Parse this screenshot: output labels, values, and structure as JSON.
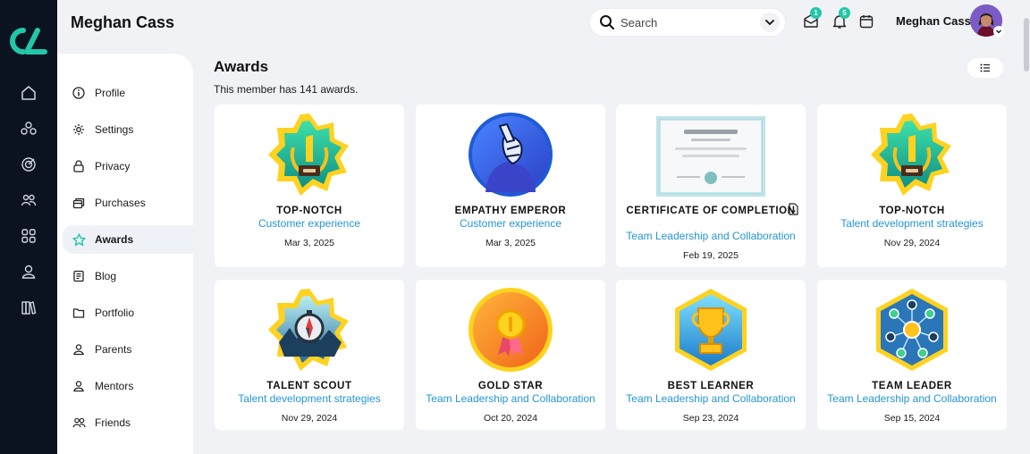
{
  "header": {
    "user_title": "Meghan Cass",
    "search_placeholder": "Search",
    "mail_badge": "1",
    "notifications_badge": "5",
    "user_name": "Meghan Cass"
  },
  "rail": {
    "icons": [
      "home-icon",
      "network-icon",
      "target-icon",
      "users-icon",
      "grid-icon",
      "user-icon",
      "library-icon"
    ]
  },
  "sidebar": {
    "items": [
      {
        "label": "Profile",
        "icon": "info-icon"
      },
      {
        "label": "Settings",
        "icon": "gear-icon"
      },
      {
        "label": "Privacy",
        "icon": "lock-icon"
      },
      {
        "label": "Purchases",
        "icon": "cards-icon"
      },
      {
        "label": "Awards",
        "icon": "star-icon",
        "active": true
      },
      {
        "label": "Blog",
        "icon": "document-icon"
      },
      {
        "label": "Portfolio",
        "icon": "folder-icon"
      },
      {
        "label": "Parents",
        "icon": "person-icon"
      },
      {
        "label": "Mentors",
        "icon": "person-icon"
      },
      {
        "label": "Friends",
        "icon": "group-icon"
      }
    ]
  },
  "main": {
    "title": "Awards",
    "subtitle": "This member has 141 awards.",
    "awards": [
      {
        "name": "TOP-NOTCH",
        "category": "Customer experience",
        "date": "Mar 3, 2025",
        "badge": "top-notch-badge"
      },
      {
        "name": "EMPATHY EMPEROR",
        "category": "Customer experience",
        "date": "Mar 3, 2025",
        "badge": "empathy-emperor-badge"
      },
      {
        "name": "CERTIFICATE OF COMPLETION",
        "category": "Team Leadership and Collaboration",
        "date": "Feb 19, 2025",
        "badge": "certificate-image"
      },
      {
        "name": "TOP-NOTCH",
        "category": "Talent development strategies",
        "date": "Nov 29, 2024",
        "badge": "top-notch-badge"
      },
      {
        "name": "TALENT SCOUT",
        "category": "Talent development strategies",
        "date": "Nov 29, 2024",
        "badge": "talent-scout-badge"
      },
      {
        "name": "GOLD STAR",
        "category": "Team Leadership and Collaboration",
        "date": "Oct 20, 2024",
        "badge": "gold-star-badge"
      },
      {
        "name": "BEST LEARNER",
        "category": "Team Leadership and Collaboration",
        "date": "Sep 23, 2024",
        "badge": "best-learner-badge"
      },
      {
        "name": "TEAM LEADER",
        "category": "Team Leadership and Collaboration",
        "date": "Sep 15, 2024",
        "badge": "team-leader-badge"
      }
    ]
  },
  "colors": {
    "rail": "#0b1220",
    "accent": "#21c7a8",
    "link": "#2596d1",
    "background": "#f1f2f6"
  }
}
